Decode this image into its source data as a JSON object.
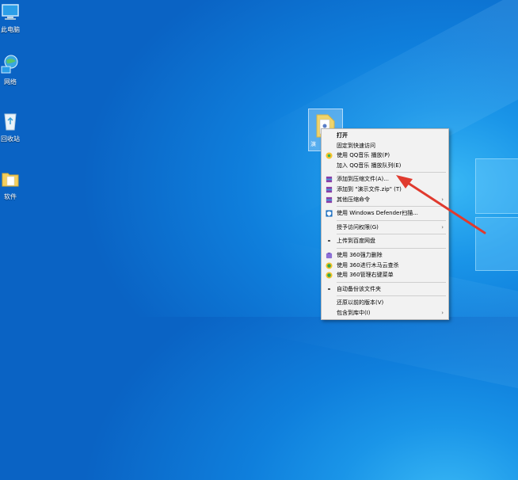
{
  "desktop": {
    "icons": [
      {
        "label": "此电脑",
        "icon": "computer-icon"
      },
      {
        "label": "网络",
        "icon": "network-icon"
      },
      {
        "label": "回收站",
        "icon": "recycle-bin-icon"
      },
      {
        "label": "软件",
        "icon": "folder-icon"
      }
    ],
    "selected_file_label": "演"
  },
  "context_menu": {
    "items": [
      {
        "label": "打开",
        "bold": true,
        "icon": "none"
      },
      {
        "label": "固定到快速访问",
        "icon": "none"
      },
      {
        "label": "使用 QQ音乐 播放(P)",
        "icon": "qq-music-icon"
      },
      {
        "label": "加入 QQ音乐 播放队列(E)",
        "icon": "none"
      },
      {
        "label": "添加到压缩文件(A)...",
        "icon": "winrar-icon"
      },
      {
        "label": "添加到 \"演示文件.zip\" (T)",
        "icon": "winrar-icon"
      },
      {
        "label": "其他压缩命令",
        "icon": "winrar-icon",
        "submenu": true
      },
      {
        "label": "使用 Windows Defender扫描...",
        "icon": "defender-shield-icon"
      },
      {
        "label": "授予访问权限(G)",
        "icon": "none",
        "submenu": true
      },
      {
        "label": "上传到百度网盘",
        "icon": "dot"
      },
      {
        "label": "使用 360强力删除",
        "icon": "360-delete-icon"
      },
      {
        "label": "使用 360进行木马云查杀",
        "icon": "360-scan-icon"
      },
      {
        "label": "使用 360管理右键菜单",
        "icon": "360-manage-icon"
      },
      {
        "label": "自动备份该文件夹",
        "icon": "dot"
      },
      {
        "label": "还原以前的版本(V)",
        "icon": "none"
      },
      {
        "label": "包含到库中(I)",
        "icon": "none",
        "submenu": true
      }
    ],
    "submenu_arrow": "›"
  },
  "annotation": {
    "color": "#e03a2e"
  },
  "colors": {
    "menu_bg": "#f2f2f2",
    "desktop_blue": "#0f7fdc"
  }
}
